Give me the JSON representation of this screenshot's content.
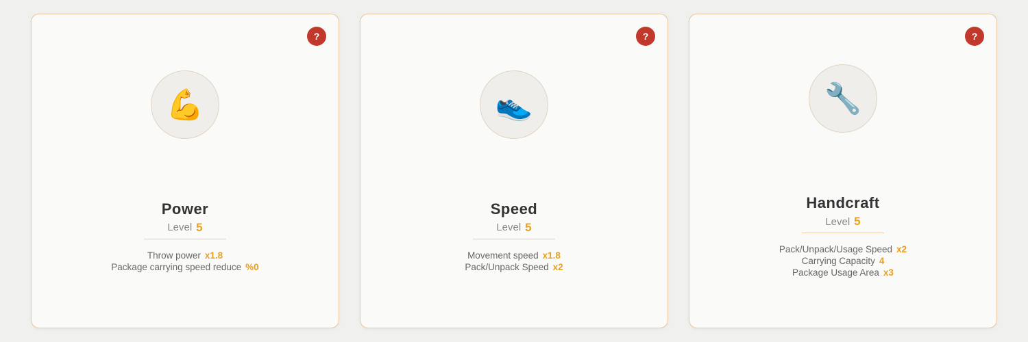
{
  "cards": [
    {
      "id": "power",
      "title": "Power",
      "level_label": "Level",
      "level_value": "5",
      "icon": "💪",
      "stats": [
        {
          "label": "Throw power",
          "value": "x1.8"
        },
        {
          "label": "Package carrying speed reduce",
          "value": "%0"
        }
      ],
      "help": "?"
    },
    {
      "id": "speed",
      "title": "Speed",
      "level_label": "Level",
      "level_value": "5",
      "icon": "👟",
      "stats": [
        {
          "label": "Movement speed",
          "value": "x1.8"
        },
        {
          "label": "Pack/Unpack Speed",
          "value": "x2"
        }
      ],
      "help": "?"
    },
    {
      "id": "handcraft",
      "title": "Handcraft",
      "level_label": "Level",
      "level_value": "5",
      "icon": "🔧",
      "stats": [
        {
          "label": "Pack/Unpack/Usage Speed",
          "value": "x2"
        },
        {
          "label": "Carrying Capacity",
          "value": "4"
        },
        {
          "label": "Package Usage Area",
          "value": "x3"
        }
      ],
      "help": "?"
    }
  ]
}
